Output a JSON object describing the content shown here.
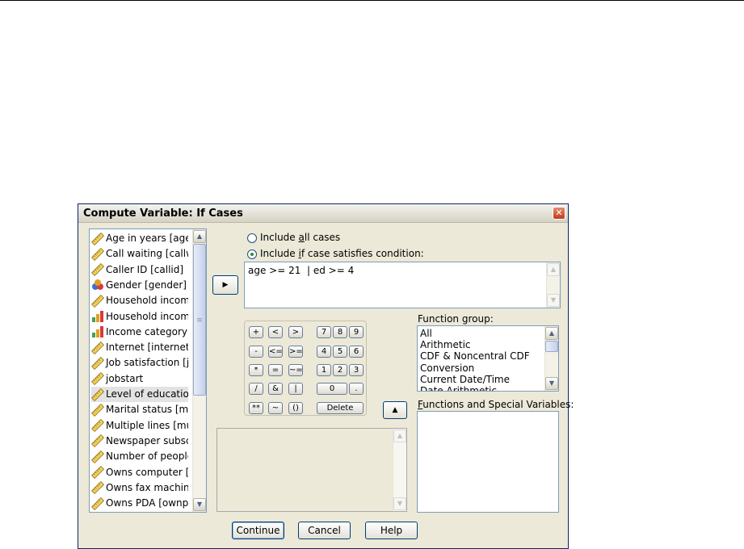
{
  "dialog": {
    "title": "Compute Variable: If Cases",
    "close_glyph": "✕"
  },
  "variables": [
    {
      "label": "Age in years [age]",
      "icon": "scale-ruler-icon"
    },
    {
      "label": "Call waiting [callwa",
      "icon": "scale-ruler-icon"
    },
    {
      "label": "Caller ID [callid]",
      "icon": "scale-ruler-icon"
    },
    {
      "label": "Gender [gender]",
      "icon": "nominal-icon"
    },
    {
      "label": "Household income",
      "icon": "scale-ruler-icon"
    },
    {
      "label": "Household income",
      "icon": "ordinal-bars-icon"
    },
    {
      "label": "Income category ir",
      "icon": "ordinal-bars-icon"
    },
    {
      "label": "Internet [internet]",
      "icon": "scale-ruler-icon"
    },
    {
      "label": "Job satisfaction [jo",
      "icon": "scale-ruler-icon"
    },
    {
      "label": "jobstart",
      "icon": "scale-ruler-icon"
    },
    {
      "label": "Level of education",
      "icon": "scale-ruler-icon"
    },
    {
      "label": "Marital status [mari",
      "icon": "scale-ruler-icon"
    },
    {
      "label": "Multiple lines [mult",
      "icon": "scale-ruler-icon"
    },
    {
      "label": "Newspaper subscr",
      "icon": "scale-ruler-icon"
    },
    {
      "label": "Number of people",
      "icon": "scale-ruler-icon"
    },
    {
      "label": "Owns computer [o",
      "icon": "scale-ruler-icon"
    },
    {
      "label": "Owns fax machine",
      "icon": "scale-ruler-icon"
    },
    {
      "label": "Owns PDA [ownpd",
      "icon": "scale-ruler-icon"
    }
  ],
  "selected_variable_index": 10,
  "options": {
    "all_cases_pre": "Include ",
    "all_cases_mn": "a",
    "all_cases_post": "ll cases",
    "if_case_pre": "Include ",
    "if_case_mn": "i",
    "if_case_post": "f case satisfies condition:",
    "selected": "if_case"
  },
  "condition_expression": "age >= 21  | ed >= 4",
  "keypad": {
    "row1": [
      "+",
      "<",
      ">",
      "7",
      "8",
      "9"
    ],
    "row2": [
      "-",
      "<=",
      ">=",
      "4",
      "5",
      "6"
    ],
    "row3": [
      "*",
      "=",
      "~=",
      "1",
      "2",
      "3"
    ],
    "row4": [
      "/",
      "&",
      "|",
      "0",
      "."
    ],
    "row5": [
      "**",
      "~",
      "()",
      "Delete"
    ]
  },
  "function_group": {
    "label_pre": "",
    "label_mn": "",
    "label_post": "Function group:",
    "items": [
      "All",
      "Arithmetic",
      "CDF & Noncentral CDF",
      "Conversion",
      "Current Date/Time",
      "Date Arithmetic"
    ]
  },
  "functions_special": {
    "label_mn": "F",
    "label_post": "unctions and Special Variables:"
  },
  "buttons": {
    "continue": "Continue",
    "cancel": "Cancel",
    "help": "Help"
  },
  "arrows": {
    "move_right": "▶",
    "move_up": "▲",
    "scroll_up": "▲",
    "scroll_down": "▼",
    "grip": "≡"
  }
}
